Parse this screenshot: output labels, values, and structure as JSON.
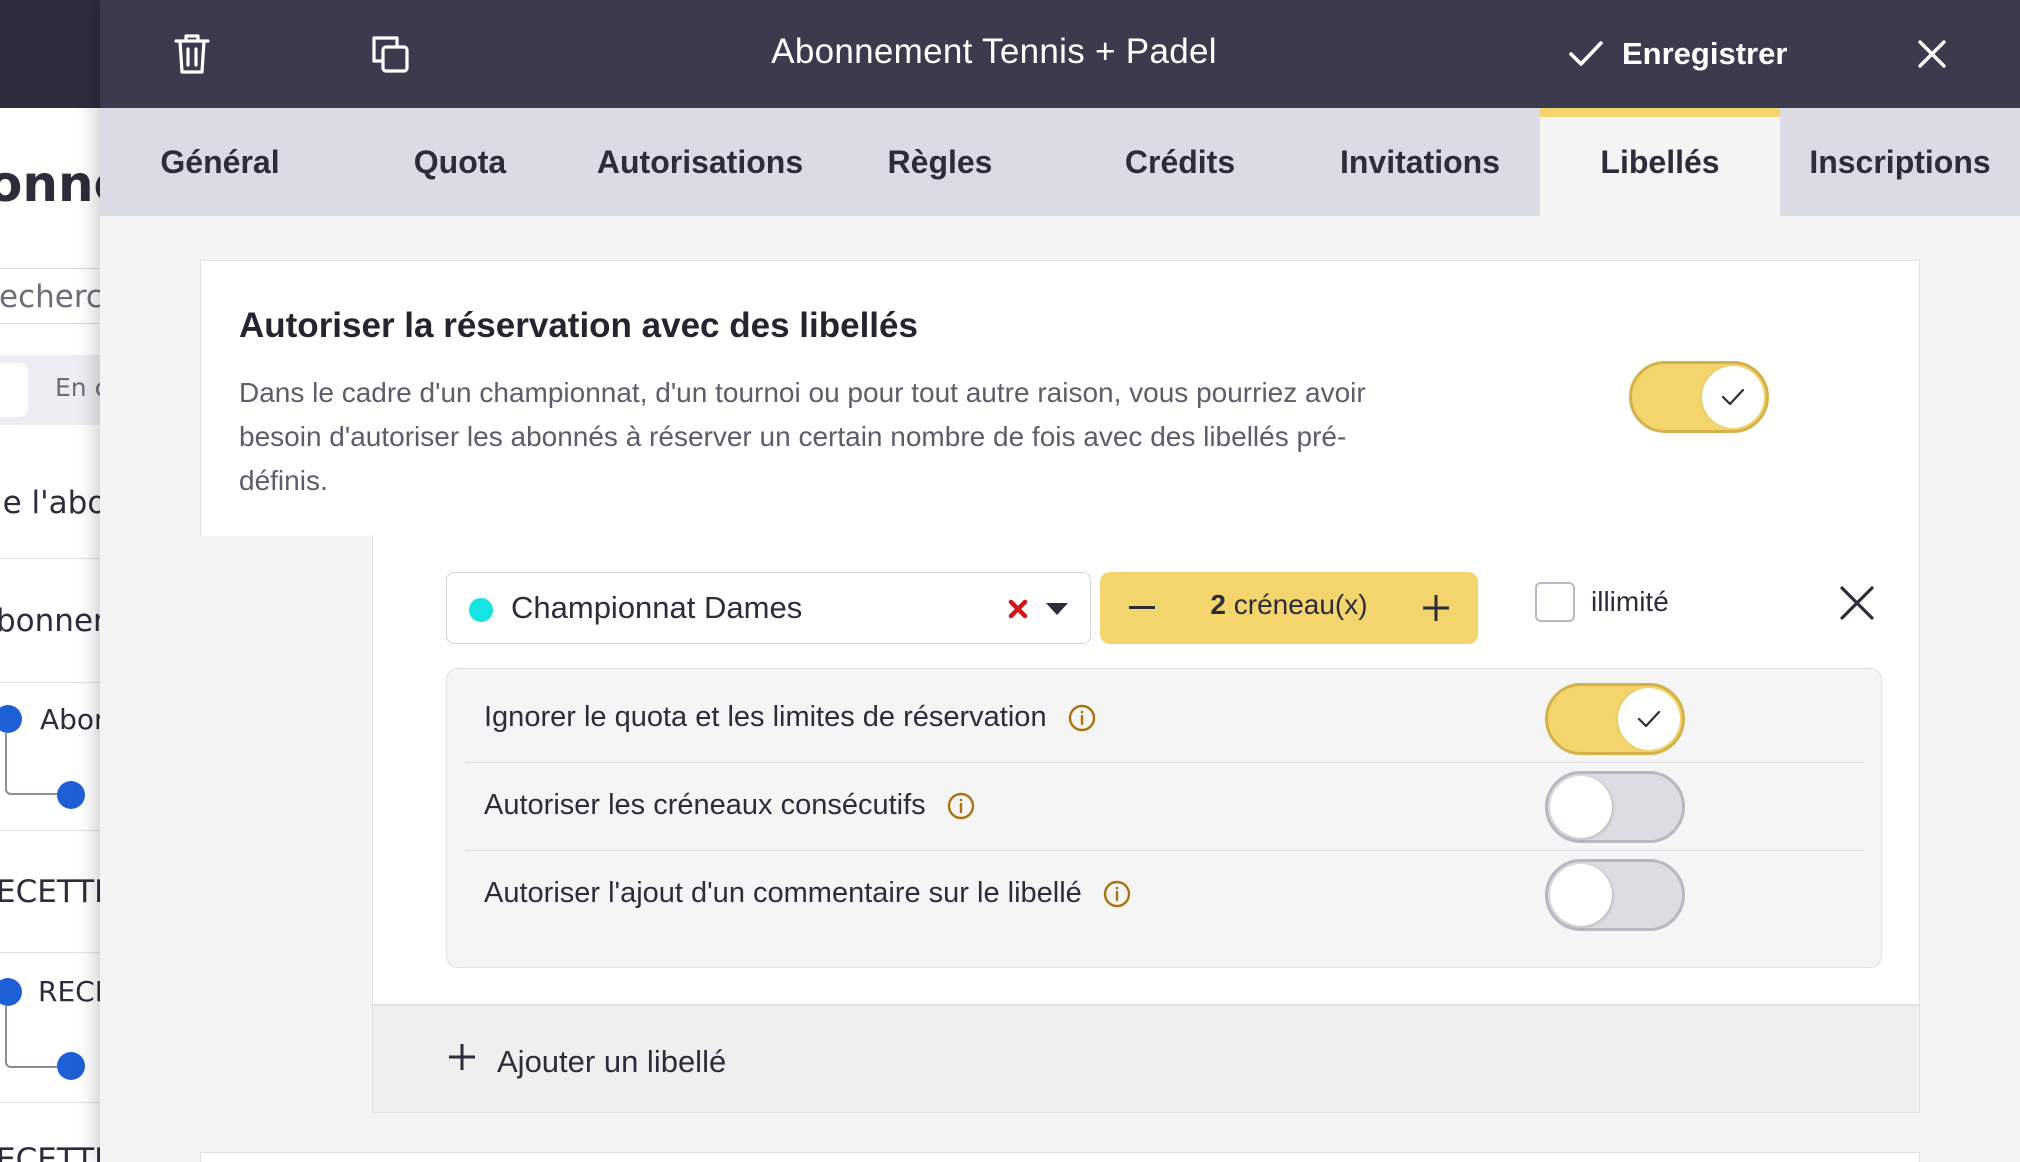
{
  "background": {
    "title_fragment": "onne",
    "search_fragment": "echercl",
    "tab_fragment": "En c",
    "row1_fragment": "le l'abo",
    "row2_fragment": "bonner",
    "row3_fragment": "Abon",
    "row4_fragment": "ECETTE",
    "row5_fragment": "RECE",
    "row6_fragment": "ECETTE"
  },
  "header": {
    "title": "Abonnement Tennis + Padel",
    "save_label": "Enregistrer",
    "icons": [
      "trash-icon",
      "duplicate-icon",
      "check-icon",
      "close-icon"
    ]
  },
  "tabs": [
    {
      "label": "Général",
      "active": false
    },
    {
      "label": "Quota",
      "active": false
    },
    {
      "label": "Autorisations",
      "active": false
    },
    {
      "label": "Règles",
      "active": false
    },
    {
      "label": "Crédits",
      "active": false
    },
    {
      "label": "Invitations",
      "active": false
    },
    {
      "label": "Libellés",
      "active": true
    },
    {
      "label": "Inscriptions",
      "active": false
    }
  ],
  "section": {
    "title": "Autoriser la réservation avec des libellés",
    "description": "Dans le cadre d'un championnat, d'un tournoi ou pour tout autre raison, vous pourriez avoir besoin d'autoriser les abonnés à réserver un certain nombre de fois avec des libellés pré-définis.",
    "enabled": true
  },
  "rule": {
    "label": "Championnat Dames",
    "label_color": "#17e3e3",
    "count": "2",
    "count_unit": "créneau(x)",
    "unlimited_label": "illimité",
    "unlimited": false,
    "options": [
      {
        "label": "Ignorer le quota et les limites de réservation",
        "enabled": true
      },
      {
        "label": "Autoriser les créneaux consécutifs",
        "enabled": false
      },
      {
        "label": "Autoriser l'ajout d'un commentaire sur le libellé",
        "enabled": false
      }
    ]
  },
  "add_label": "Ajouter un libellé",
  "colors": {
    "header_bg": "#3a3c4e",
    "tabs_bg": "#d9dbe5",
    "accent": "#f3d46d",
    "info_icon": "#a7740f",
    "clear_icon": "#d0161a",
    "bg_dot": "#1f5fd6"
  }
}
